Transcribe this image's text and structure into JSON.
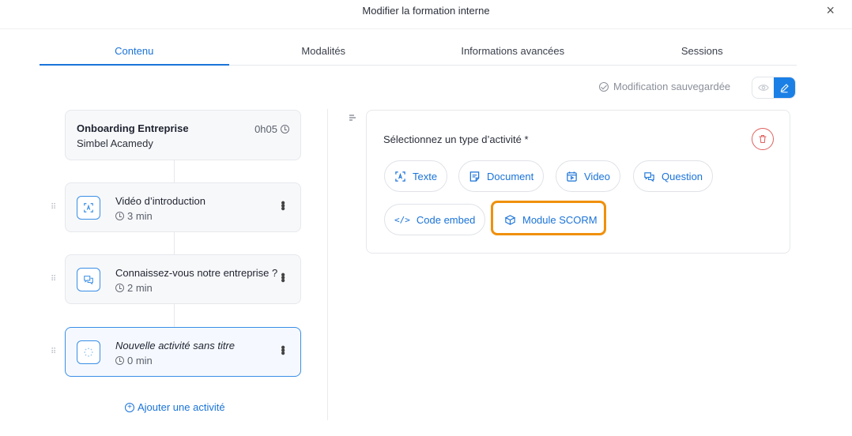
{
  "header": {
    "title": "Modifier la formation interne",
    "close_label": "×"
  },
  "tabs": [
    {
      "label": "Contenu",
      "active": true
    },
    {
      "label": "Modalités",
      "active": false
    },
    {
      "label": "Informations avancées",
      "active": false
    },
    {
      "label": "Sessions",
      "active": false
    }
  ],
  "status": {
    "saved_label": "Modification sauvegardée"
  },
  "course": {
    "name": "Onboarding Entreprise",
    "organization": "Simbel Acamedy",
    "duration": "0h05"
  },
  "activities": [
    {
      "title": "Vidéo d’introduction",
      "duration": "3 min",
      "icon": "text-scan-icon"
    },
    {
      "title": "Connaissez-vous notre entreprise ?",
      "duration": "2 min",
      "icon": "question-icon"
    },
    {
      "title": "Nouvelle activité sans titre",
      "duration": "0 min",
      "icon": "loading-icon",
      "selected": true
    }
  ],
  "add_activity_label": "Ajouter une activité",
  "activity_panel": {
    "label": "Sélectionnez un type d’activité *",
    "types": [
      "Texte",
      "Document",
      "Video",
      "Question",
      "Code embed",
      "Module SCORM"
    ],
    "highlighted": "Module SCORM"
  },
  "colors": {
    "accent": "#1a73d9",
    "highlight": "#f0900a",
    "danger": "#e06060"
  }
}
